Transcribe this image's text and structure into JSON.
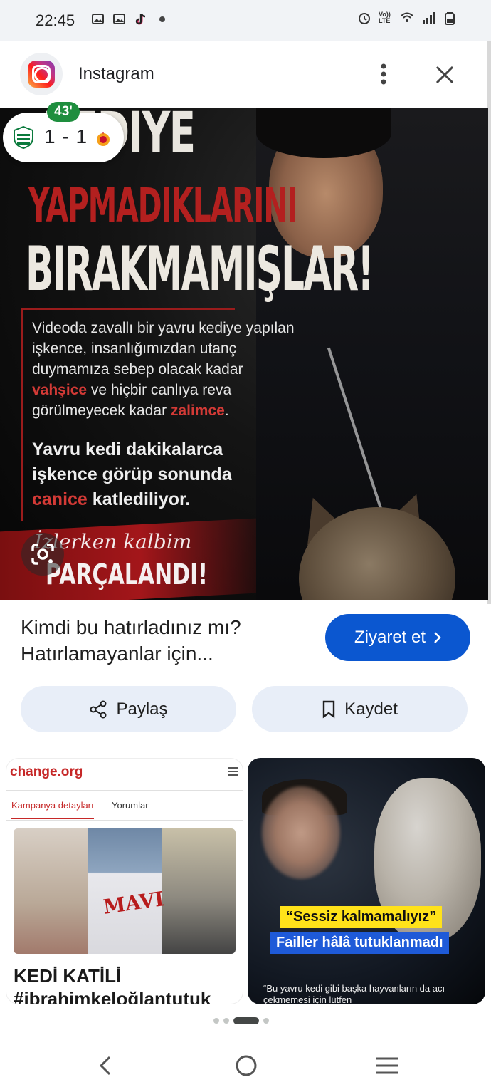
{
  "status_bar": {
    "time": "22:45",
    "network": "Vo)) LTE",
    "icons": [
      "gallery-icon",
      "gallery-icon",
      "tiktok-icon",
      "dot-icon",
      "alarm-icon",
      "wifi-icon",
      "signal-icon",
      "battery-icon"
    ]
  },
  "header": {
    "app_name": "Instagram",
    "more_icon": "more-vertical-icon",
    "close_icon": "close-icon"
  },
  "score_widget": {
    "minute": "43'",
    "score": "1 - 1"
  },
  "hero": {
    "line1": "KEDIYE",
    "line2": "YAPMADIKLARINI",
    "line3": "BIRAKMAMIŞLAR!",
    "para1_a": "Videoda zavallı bir yavru kediye yapılan işkence, insanlığımızdan utanç duymamıza sebep olacak kadar ",
    "para1_b": "vahşice",
    "para1_c": " ve hiçbir canlıya reva görülmeyecek kadar ",
    "para1_d": "zalimce",
    "para1_e": ".",
    "para2_a": "Yavru kedi dakikalarca işkence görüp sonunda ",
    "para2_b": "canice",
    "para2_c": " katlediliyor.",
    "script": "İzlerken kalbim",
    "shout": "PARÇALANDI!",
    "lens_icon": "lens-icon"
  },
  "result": {
    "caption": "Kimdi bu hatırladınız mı? Hatırlamayanlar için...",
    "visit_label": "Ziyaret et",
    "share_label": "Paylaş",
    "save_label": "Kaydet"
  },
  "cards": {
    "left": {
      "logo": "change.org",
      "tab1": "Kampanya detayları",
      "tab2": "Yorumlar",
      "shirt_text": "MAVI",
      "title1": "KEDİ KATİLİ",
      "title2": "#ibrahimkeloğlantutuk"
    },
    "right": {
      "sticker1": "“Sessiz kalmamalıyız”",
      "sticker2": "Failler hâlâ tutuklanmadı",
      "quote": "“Bu yavru kedi gibi başka hayvanların da acı çekmemesi için lütfen"
    }
  },
  "pager": {
    "count": 4,
    "active_index": 2
  },
  "nav_bar": {
    "back_icon": "back-icon",
    "home_icon": "home-icon",
    "recents_icon": "recents-icon"
  },
  "colors": {
    "accent_blue": "#0b57d0",
    "tonal_button": "#e8eef8",
    "hero_red": "#d23a36",
    "live_green": "#1e8e3e"
  }
}
